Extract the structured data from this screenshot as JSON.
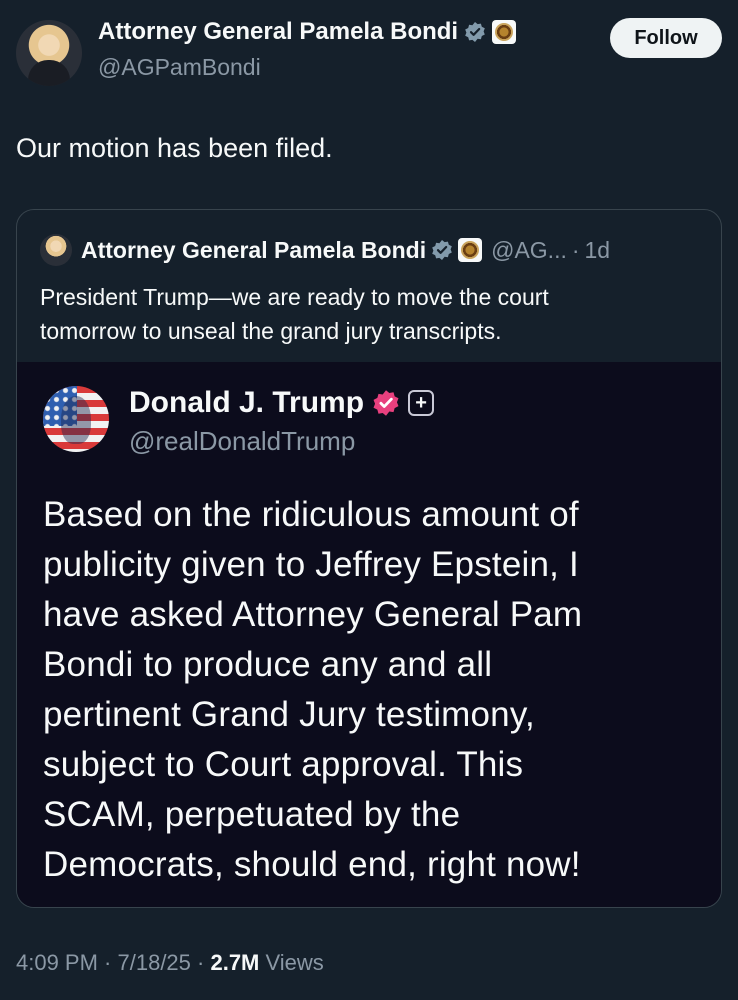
{
  "author": {
    "name": "Attorney General Pamela Bondi",
    "handle": "@AGPamBondi",
    "follow_label": "Follow"
  },
  "post": {
    "text": "Our motion has been filed."
  },
  "quoted": {
    "name": "Attorney General Pamela Bondi",
    "handle": "@AG...",
    "separator": "·",
    "time": "1d",
    "text_line1": "President Trump—we are ready to move the court",
    "text_line2": "tomorrow to unseal the grand jury transcripts.",
    "media": {
      "name": "Donald J. Trump",
      "handle": "@realDonaldTrump",
      "plus_icon": "+",
      "lines": [
        "Based on the ridiculous amount of",
        "publicity given to Jeffrey Epstein, I",
        "have asked Attorney General Pam",
        "Bondi to produce any and all",
        "pertinent Grand Jury testimony,",
        "subject to Court approval. This",
        "SCAM, perpetuated by the",
        "Democrats, should end, right now!"
      ]
    }
  },
  "footer": {
    "time": "4:09 PM",
    "sep1": " · ",
    "date": "7/18/25",
    "sep2": " · ",
    "views_count": "2.7M",
    "views_label": " Views"
  },
  "icons": {
    "verified_color": "#829aab",
    "truth_verified_color": "#e8407e"
  }
}
